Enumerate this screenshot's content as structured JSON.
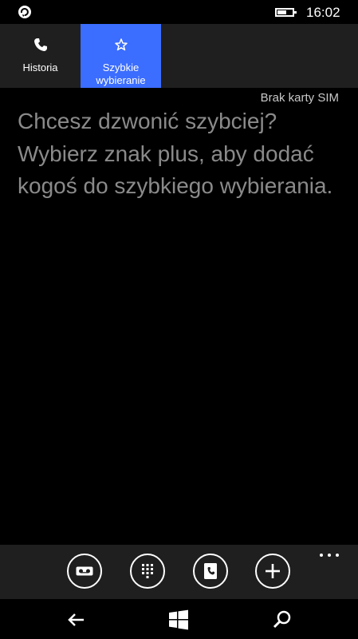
{
  "status_bar": {
    "time": "16:02",
    "battery_level": 0.55
  },
  "tabs": [
    {
      "label": "Historia",
      "icon": "phone-icon",
      "active": false
    },
    {
      "label": "Szybkie wybieranie",
      "icon": "star-icon",
      "active": true
    }
  ],
  "sim_status": "Brak karty SIM",
  "empty_message": "Chcesz dzwonić szybciej? Wybierz znak plus, aby dodać kogoś do szybkiego wybierania.",
  "app_bar": {
    "buttons": [
      "voicemail-icon",
      "keypad-icon",
      "contacts-icon",
      "add-icon"
    ],
    "more": "more-icon"
  },
  "nav_bar": {
    "buttons": [
      "back-icon",
      "windows-icon",
      "search-icon"
    ]
  },
  "colors": {
    "accent": "#3b6dff",
    "background": "#000000",
    "bar": "#1f1f1f",
    "text_dim": "#8a8a8a"
  }
}
